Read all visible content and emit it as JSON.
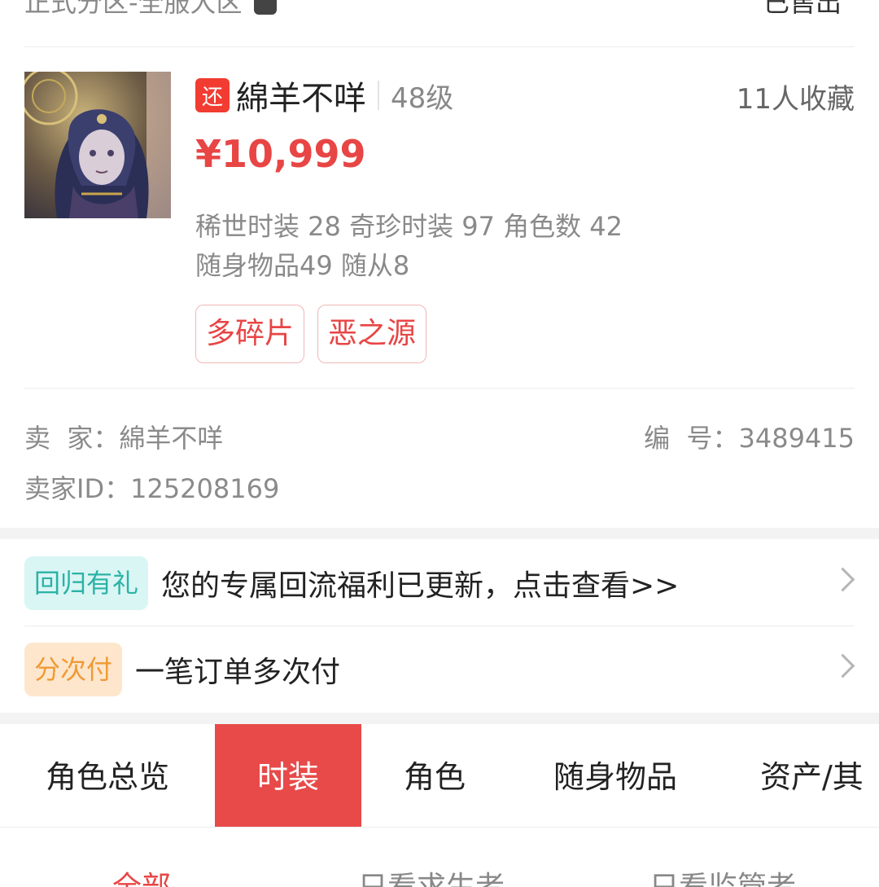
{
  "top": {
    "server": "正式分区-全服大区",
    "status": "已售出"
  },
  "product": {
    "return_badge": "还",
    "role_name": "綿羊不咩",
    "level": "48级",
    "favorites": "11人收藏",
    "price": "¥10,999",
    "stats_line1": "稀世时装 28 奇珍时装 97 角色数 42",
    "stats_line2": "随身物品49 随从8",
    "tags": [
      "多碎片",
      "恶之源"
    ]
  },
  "seller": {
    "seller_label": "卖  家：",
    "seller_name": "綿羊不咩",
    "number_label": "编  号：",
    "number": "3489415",
    "id_label": "卖家ID：",
    "id": "125208169"
  },
  "promos": [
    {
      "badge": "回归有礼",
      "text": "您的专属回流福利已更新，点击查看>>",
      "color": "#2cb2a6"
    },
    {
      "badge": "分次付",
      "text": "一笔订单多次付",
      "color": "#f09a36"
    }
  ],
  "tabs": [
    {
      "label": "角色总览",
      "active": false
    },
    {
      "label": "时装",
      "active": true
    },
    {
      "label": "角色",
      "active": false
    },
    {
      "label": "随身物品",
      "active": false
    },
    {
      "label": "资产/其",
      "active": false
    }
  ],
  "filters": [
    {
      "label": "全部",
      "active": true
    },
    {
      "label": "只看求生者",
      "active": false
    },
    {
      "label": "只看监管者",
      "active": false
    }
  ],
  "colors": {
    "accent": "#e84a4a",
    "price": "#e84545"
  }
}
